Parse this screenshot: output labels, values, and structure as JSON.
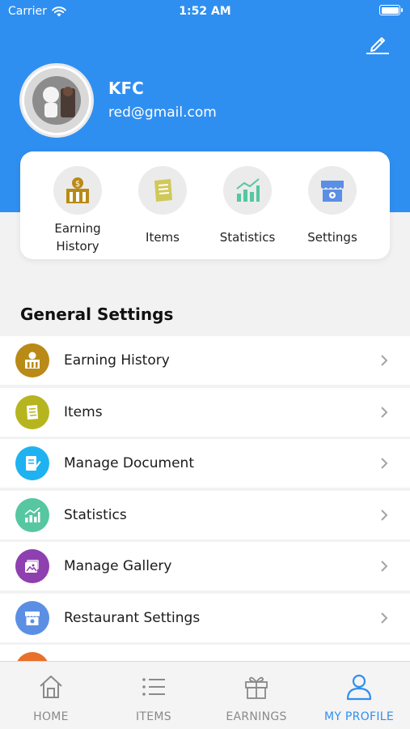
{
  "status_bar": {
    "carrier": "Carrier",
    "time": "1:52 AM"
  },
  "profile": {
    "name": "KFC",
    "email": "red@gmail.com",
    "avatar_icon": "kfc-logo-avatar"
  },
  "quick_actions": [
    {
      "label_line1": "Earning",
      "label_line2": "History",
      "icon": "earning-history-icon"
    },
    {
      "label_line1": "Items",
      "label_line2": "",
      "icon": "items-icon"
    },
    {
      "label_line1": "Statistics",
      "label_line2": "",
      "icon": "statistics-icon"
    },
    {
      "label_line1": "Settings",
      "label_line2": "",
      "icon": "settings-store-icon"
    }
  ],
  "general_settings": {
    "title": "General Settings",
    "items": [
      {
        "label": "Earning History",
        "icon": "earning-history-icon",
        "color": "#b98a16"
      },
      {
        "label": "Items",
        "icon": "items-icon",
        "color": "#b7b51f"
      },
      {
        "label": "Manage Document",
        "icon": "document-icon",
        "color": "#1fb2f0"
      },
      {
        "label": "Statistics",
        "icon": "statistics-icon",
        "color": "#56c7a0"
      },
      {
        "label": "Manage Gallery",
        "icon": "gallery-icon",
        "color": "#8e3fb0"
      },
      {
        "label": "Restaurant Settings",
        "icon": "restaurant-icon",
        "color": "#5b8fe4"
      }
    ]
  },
  "tabs": [
    {
      "label": "HOME",
      "icon": "home-icon",
      "active": false
    },
    {
      "label": "ITEMS",
      "icon": "list-icon",
      "active": false
    },
    {
      "label": "EARNINGS",
      "icon": "gift-icon",
      "active": false
    },
    {
      "label": "MY PROFILE",
      "icon": "person-icon",
      "active": true
    }
  ],
  "colors": {
    "primary": "#2f8ff0",
    "background": "#f2f2f2"
  }
}
